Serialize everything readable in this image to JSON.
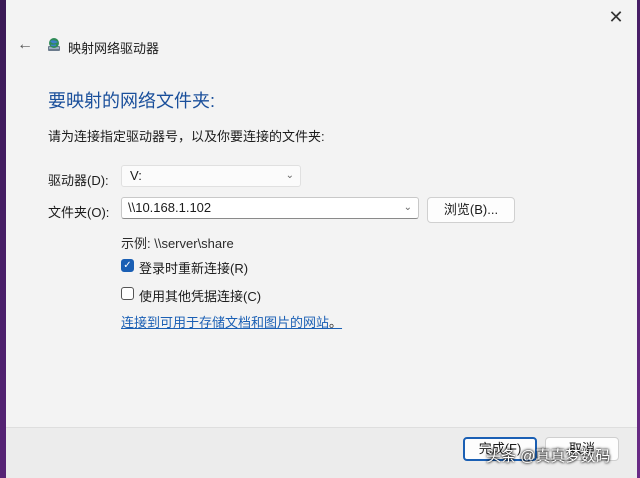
{
  "window": {
    "close_glyph": "✕",
    "back_glyph": "←",
    "title": "映射网络驱动器",
    "icon": "network-drive-globe-icon"
  },
  "content": {
    "heading": "要映射的网络文件夹:",
    "instruction": "请为连接指定驱动器号，以及你要连接的文件夹:",
    "drive_label": "驱动器(D):",
    "drive_value": "V:",
    "folder_label": "文件夹(O):",
    "folder_value": "\\\\10.168.1.102",
    "browse_label": "浏览(B)...",
    "example": "示例: \\\\server\\share",
    "reconnect": {
      "label": "登录时重新连接(R)",
      "checked": true
    },
    "other_credentials": {
      "label": "使用其他凭据连接(C)",
      "checked": false
    },
    "link_text": "连接到可用于存储文档和图片的网站",
    "link_suffix": "。"
  },
  "footer": {
    "finish_label": "完成(F)",
    "cancel_label": "取消"
  },
  "watermark": "头条 @真真梦数码",
  "colors": {
    "accent": "#1a5fb4",
    "heading": "#1a4f9b",
    "desktop": "#4b1f6b"
  }
}
